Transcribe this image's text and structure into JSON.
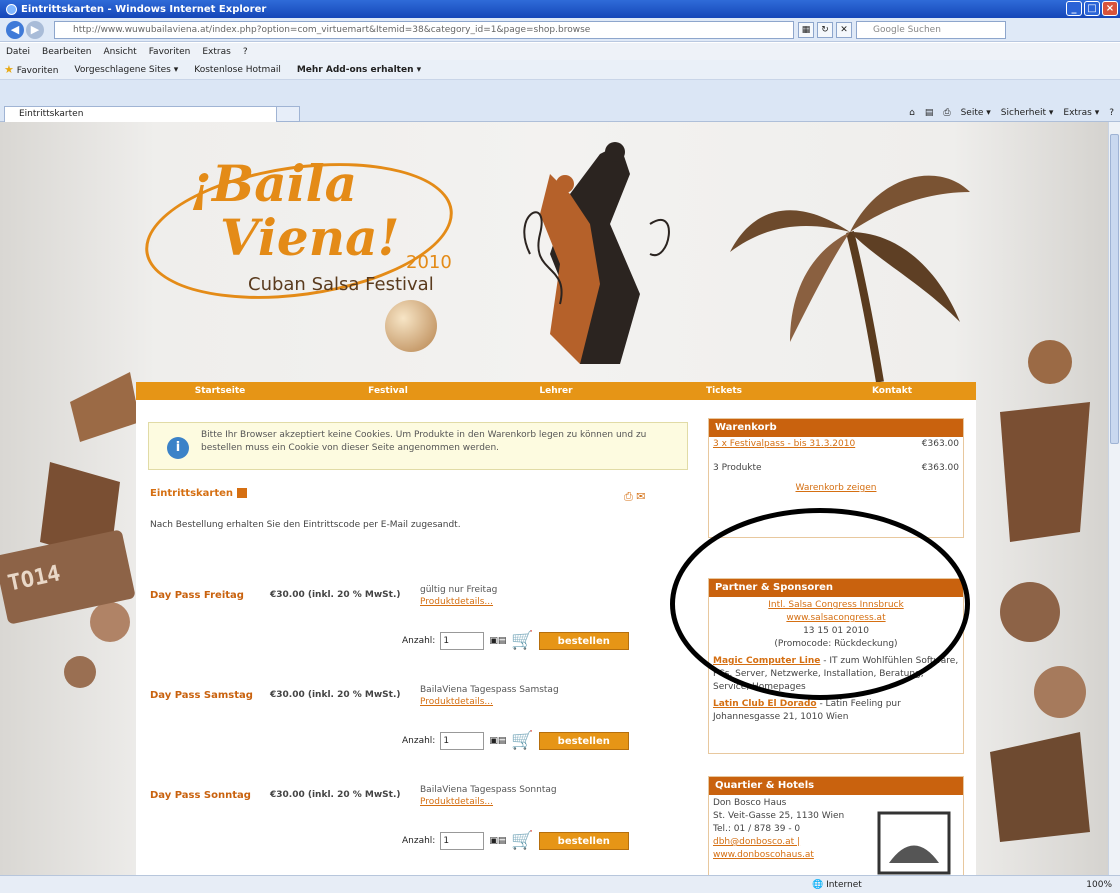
{
  "browser": {
    "title": "Eintrittskarten - Windows Internet Explorer",
    "address": "http://www.wuwubailaviena.at/index.php?option=com_virtuemart&Itemid=38&category_id=1&page=shop.browse",
    "search_placeholder": "Google Suchen",
    "menu": [
      "Datei",
      "Bearbeiten",
      "Ansicht",
      "Favoriten",
      "Extras",
      "?"
    ],
    "favorites": [
      "Favoriten",
      "Vorgeschlagene Sites ▾",
      "Kostenlose Hotmail",
      "Mehr Add-ons erhalten ▾"
    ],
    "tab_label": "Eintrittskarten",
    "commands": [
      "Seite ▾",
      "Sicherheit ▾",
      "Extras ▾"
    ],
    "status_zone": "Internet",
    "status_zoom": "100%"
  },
  "site": {
    "logo_line1": "¡Baila",
    "logo_line2": "Viena!",
    "logo_year": "2010",
    "logo_sub": "Cuban Salsa Festival",
    "plate_text": "TO14",
    "nav": [
      "Startseite",
      "Festival",
      "Lehrer",
      "Tickets",
      "Kontakt"
    ]
  },
  "main": {
    "info_text": "Bitte Ihr Browser akzeptiert keine Cookies. Um Produkte in den Warenkorb legen zu können und zu bestellen muss ein Cookie von dieser Seite angenommen werden.",
    "category_title": "Eintrittskarten",
    "note": "Nach Bestellung erhalten Sie den Eintrittscode per E-Mail zugesandt.",
    "qty_label": "Anzahl:",
    "order_label": "bestellen",
    "products": [
      {
        "name": "Day Pass Freitag",
        "price": "€30.00 (inkl. 20 % MwSt.)",
        "desc": "gültig nur Freitag",
        "link": "Produktdetails...",
        "qty": "1"
      },
      {
        "name": "Day Pass Samstag",
        "price": "€30.00 (inkl. 20 % MwSt.)",
        "desc": "BailaViena Tagespass Samstag",
        "link": "Produktdetails...",
        "qty": "1"
      },
      {
        "name": "Day Pass Sonntag",
        "price": "€30.00 (inkl. 20 % MwSt.)",
        "desc": "BailaViena Tagespass Sonntag",
        "link": "Produktdetails...",
        "qty": "1"
      }
    ]
  },
  "sidebar": {
    "cart_title": "Warenkorb",
    "cart_item": "3 x Festivalpass - bis 31.3.2010",
    "cart_item_price": "€363.00",
    "cart_total_label": "3 Produkte",
    "cart_total": "€363.00",
    "cart_link": "Warenkorb zeigen",
    "partner_title": "Partner & Sponsoren",
    "partner_lines": [
      "Intl. Salsa Congress Innsbruck",
      "www.salsacongress.at",
      "13 15 01 2010",
      "(Promocode: Rückdeckung)"
    ],
    "partner2_name": "Magic Computer Line",
    "partner2_text": "- IT zum Wohlfühlen Software, PCs, Server, Netzwerke, Installation, Beratung, Service, Homepages",
    "partner3_name": "Latin Club El Dorado",
    "partner3_text": "- Latin Feeling pur Johannesgasse 21, 1010 Wien",
    "hotel_title": "Quartier & Hotels",
    "hotel_lines": [
      "Don Bosco Haus",
      "St. Veit-Gasse 25, 1130 Wien",
      "Tel.: 01 / 878 39 - 0",
      "dbh@donbosco.at |",
      "www.donboscohaus.at"
    ]
  }
}
